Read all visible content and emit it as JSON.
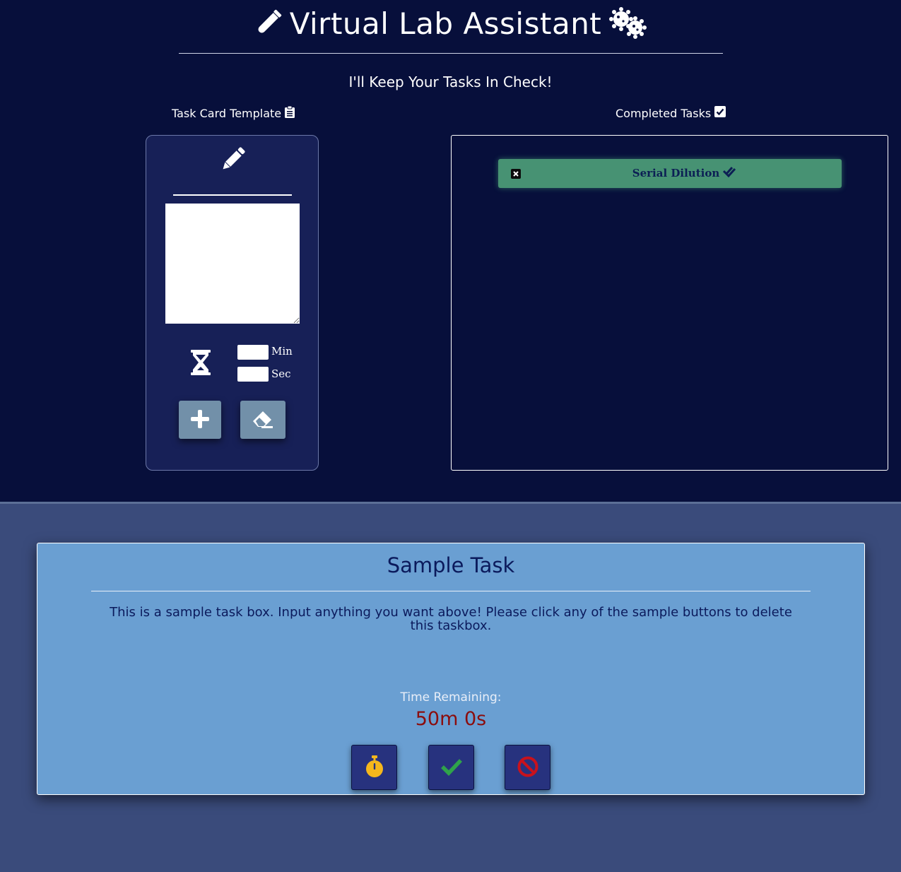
{
  "header": {
    "title": "Virtual Lab Assistant",
    "tagline": "I'll Keep Your Tasks In Check!",
    "left_icon": "flask-icon",
    "right_icon": "virus-icon"
  },
  "template": {
    "heading": "Task Card Template",
    "heading_icon": "clipboard-list-icon",
    "title_icon": "pencil-icon",
    "timer_icon": "hourglass-icon",
    "min_label": "Min",
    "sec_label": "Sec",
    "min_value": "",
    "sec_value": "",
    "description_value": "",
    "add_icon": "plus-icon",
    "clear_icon": "eraser-icon"
  },
  "completed": {
    "heading": "Completed Tasks",
    "heading_icon": "check-square-icon",
    "items": [
      {
        "label": "Serial Dilution",
        "icon": "double-check-icon",
        "remove_icon": "x-square-icon"
      }
    ]
  },
  "task": {
    "title": "Sample Task",
    "description": "This is a sample task box. Input anything you want above! Please click any of the sample buttons to delete this taskbox.",
    "time_remaining_label": "Time Remaining:",
    "time_remaining_value": "50m 0s",
    "buttons": [
      {
        "name": "stopwatch-button",
        "icon": "stopwatch-icon",
        "color": "#f5b71c"
      },
      {
        "name": "complete-button",
        "icon": "check-icon",
        "color": "#2fa34a"
      },
      {
        "name": "cancel-button",
        "icon": "ban-icon",
        "color": "#c8121c"
      }
    ]
  },
  "colors": {
    "top_background": "#070f3b",
    "bottom_background": "#3a4b7b",
    "card_background": "#172057",
    "task_background": "#6a9fd2",
    "completed_item": "#479273",
    "timer_text": "#8b0d0d",
    "action_button": "#27327e"
  }
}
